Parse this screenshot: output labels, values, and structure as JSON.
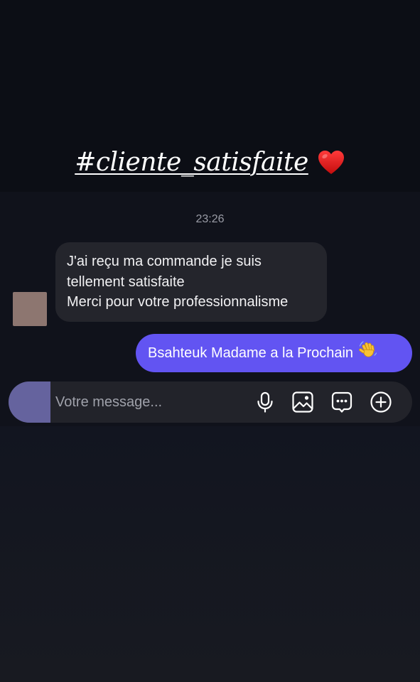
{
  "caption": {
    "text": "#cliente_satisfaite",
    "emoji": "heart-icon"
  },
  "chat": {
    "timestamp": "23:26",
    "incoming": {
      "lines": [
        "J'ai reçu ma commande je suis",
        "tellement satisfaite",
        "Merci pour votre professionnalisme"
      ]
    },
    "outgoing": {
      "text": "Bsahteuk Madame a la Prochain",
      "emoji": "waving-hand-icon"
    }
  },
  "composer": {
    "placeholder": "Votre message...",
    "icons": [
      "microphone-icon",
      "image-icon",
      "sticker-icon",
      "plus-icon"
    ]
  },
  "colors": {
    "outgoing_bubble": "#6254f2",
    "incoming_bubble": "#24252c",
    "background": "#0d0f17"
  }
}
